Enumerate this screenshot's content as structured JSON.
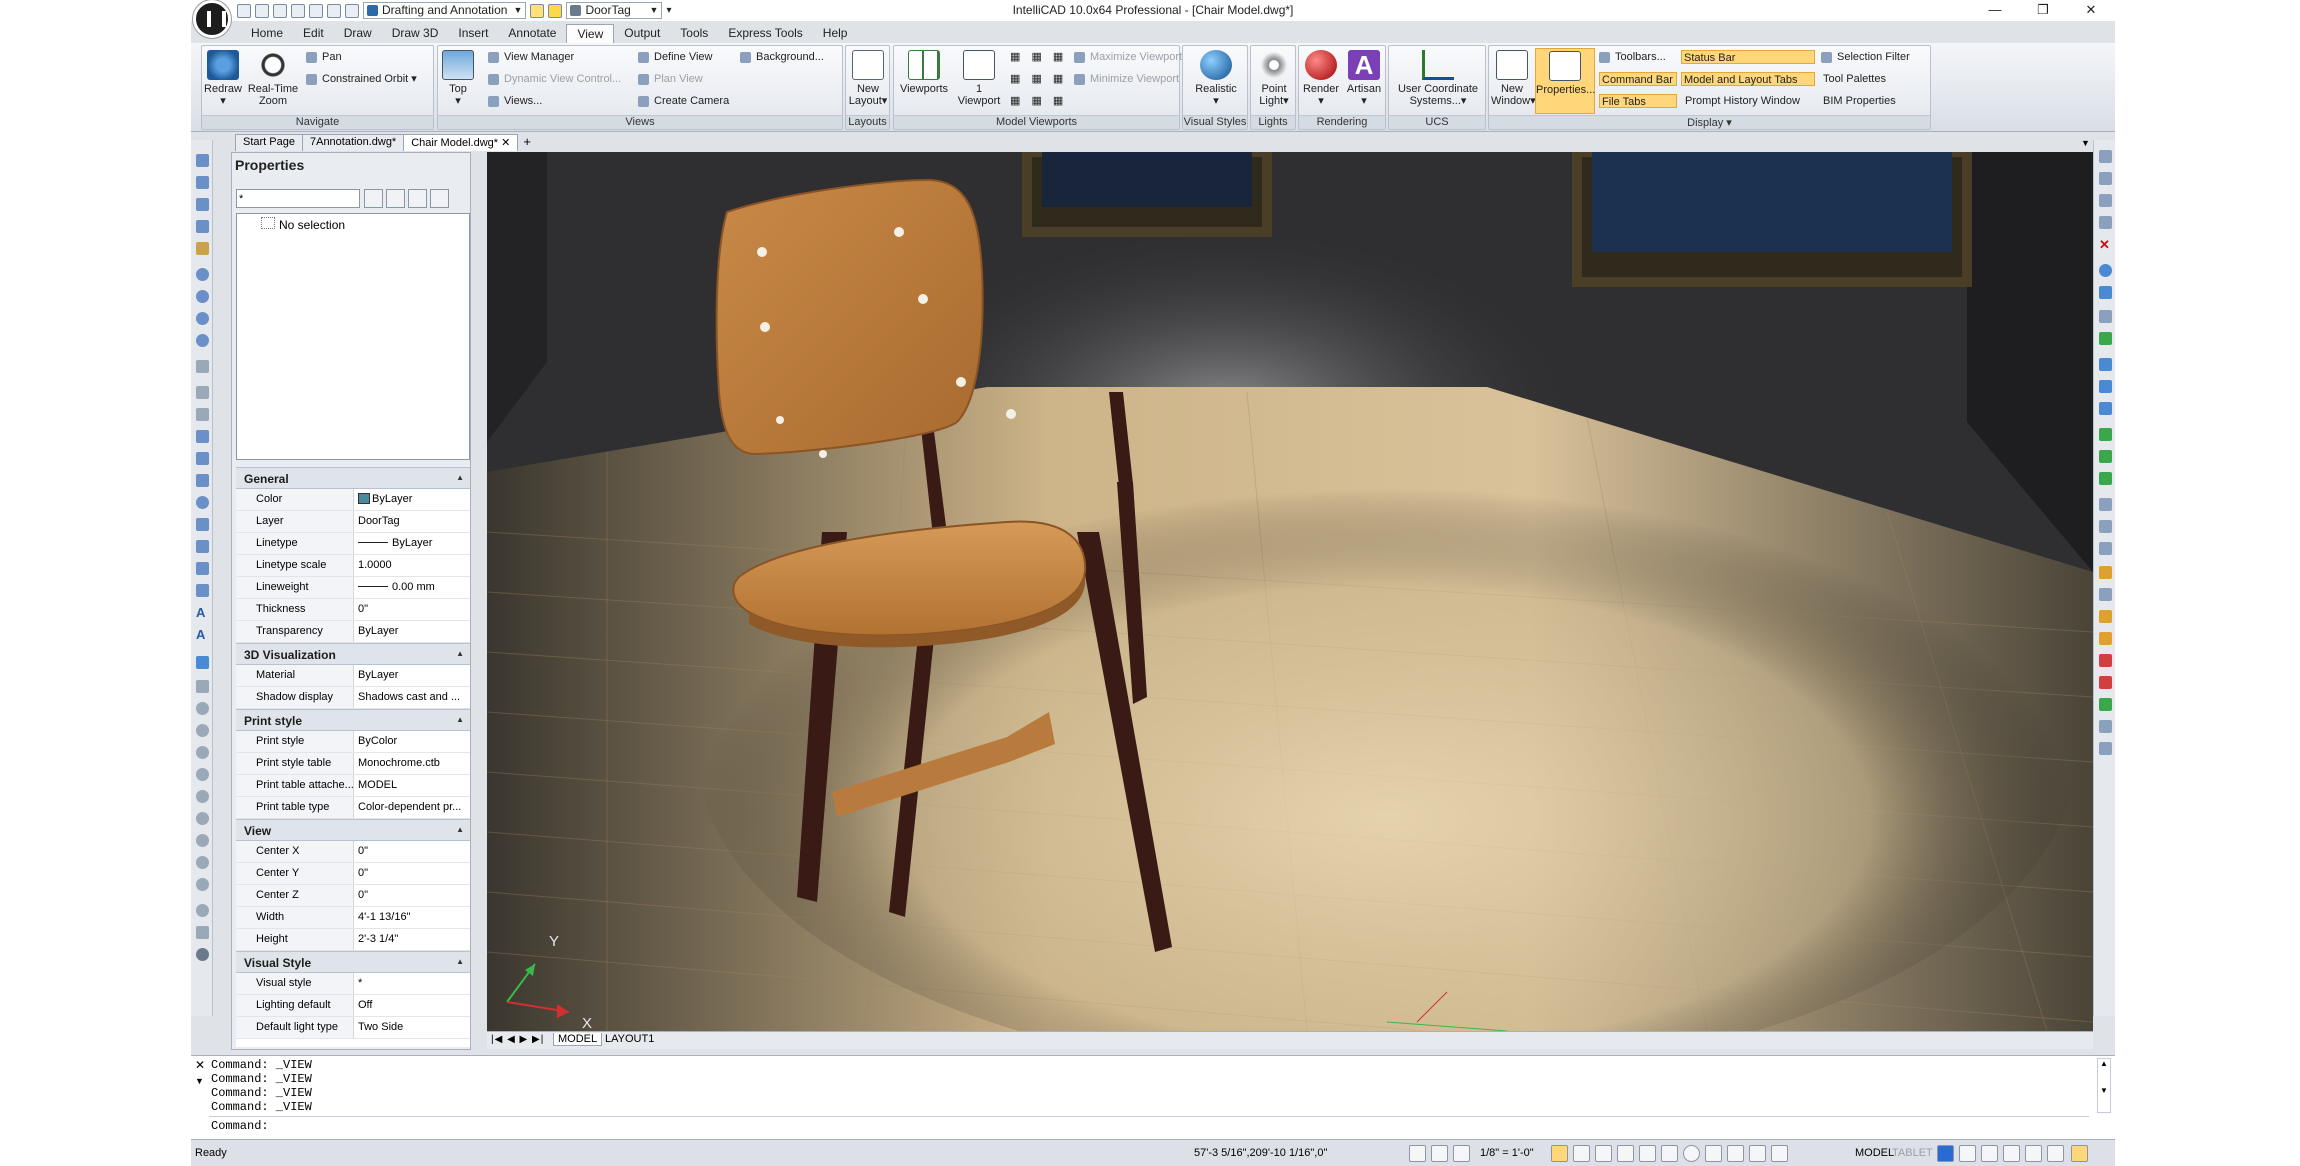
{
  "titlebar": {
    "title": "IntelliCAD 10.0x64 Professional - [Chair Model.dwg*]",
    "workspace": "Drafting and Annotation",
    "layer": "DoorTag",
    "minimize": "—",
    "restore": "❐",
    "close": "✕"
  },
  "menu": [
    "Home",
    "Edit",
    "Draw",
    "Draw 3D",
    "Insert",
    "Annotate",
    "View",
    "Output",
    "Tools",
    "Express Tools",
    "Help"
  ],
  "ribbon": {
    "navigate": {
      "title": "Navigate",
      "redraw": "Redraw",
      "realtime_zoom": "Real-Time Zoom",
      "pan": "Pan",
      "constrained_orbit": "Constrained Orbit"
    },
    "views": {
      "title": "Views",
      "top": "Top",
      "view_manager": "View Manager",
      "dynamic_view_control": "Dynamic View Control...",
      "views": "Views...",
      "define_view": "Define View",
      "plan_view": "Plan View",
      "create_camera": "Create Camera",
      "background": "Background..."
    },
    "layouts": {
      "title": "Layouts",
      "new_layout": "New Layout"
    },
    "model_viewports": {
      "title": "Model Viewports",
      "viewports": "Viewports",
      "one_viewport": "1 Viewport",
      "maximize_viewport": "Maximize Viewport",
      "minimize_viewport": "Minimize Viewport"
    },
    "visual_styles": {
      "title": "Visual Styles",
      "realistic": "Realistic"
    },
    "lights": {
      "title": "Lights",
      "point_light": "Point Light"
    },
    "rendering": {
      "title": "Rendering",
      "render": "Render",
      "artisan": "Artisan"
    },
    "ucs": {
      "title": "UCS",
      "user_coordinate_systems": "User Coordinate Systems..."
    },
    "display": {
      "title": "Display",
      "new_window": "New Window",
      "properties": "Properties...",
      "toolbars": "Toolbars...",
      "command_bar": "Command Bar",
      "file_tabs": "File Tabs",
      "status_bar": "Status Bar",
      "model_and_layout_tabs": "Model and Layout Tabs",
      "prompt_history_window": "Prompt History Window",
      "selection_filter": "Selection Filter",
      "tool_palettes": "Tool Palettes",
      "bim_properties": "BIM Properties"
    }
  },
  "doc_tabs": [
    "Start Page",
    "7Annotation.dwg*",
    "Chair Model.dwg*"
  ],
  "properties": {
    "title": "Properties",
    "filter_value": "*",
    "selection": "No selection",
    "sections": [
      {
        "name": "General",
        "rows": [
          {
            "key": "Color",
            "value": "ByLayer"
          },
          {
            "key": "Layer",
            "value": "DoorTag"
          },
          {
            "key": "Linetype",
            "value": "ByLayer"
          },
          {
            "key": "Linetype scale",
            "value": "1.0000"
          },
          {
            "key": "Lineweight",
            "value": "0.00 mm"
          },
          {
            "key": "Thickness",
            "value": "0\""
          },
          {
            "key": "Transparency",
            "value": "ByLayer"
          }
        ]
      },
      {
        "name": "3D Visualization",
        "rows": [
          {
            "key": "Material",
            "value": "ByLayer"
          },
          {
            "key": "Shadow display",
            "value": "Shadows cast and ..."
          }
        ]
      },
      {
        "name": "Print style",
        "rows": [
          {
            "key": "Print style",
            "value": "ByColor"
          },
          {
            "key": "Print style table",
            "value": "Monochrome.ctb"
          },
          {
            "key": "Print table attache...",
            "value": "MODEL"
          },
          {
            "key": "Print table type",
            "value": "Color-dependent pr..."
          }
        ]
      },
      {
        "name": "View",
        "rows": [
          {
            "key": "Center X",
            "value": "0\""
          },
          {
            "key": "Center Y",
            "value": "0\""
          },
          {
            "key": "Center Z",
            "value": "0\""
          },
          {
            "key": "Width",
            "value": "4'-1 13/16\""
          },
          {
            "key": "Height",
            "value": "2'-3 1/4\""
          }
        ]
      },
      {
        "name": "Visual Style",
        "rows": [
          {
            "key": "Visual style",
            "value": "*"
          },
          {
            "key": "Lighting default",
            "value": "Off"
          },
          {
            "key": "Default light type",
            "value": "Two Side"
          }
        ]
      }
    ]
  },
  "viewport": {
    "axis_y": "Y",
    "axis_x": "X"
  },
  "layout_tabs": [
    "MODEL",
    "LAYOUT1"
  ],
  "layout_nav": "|◀ ◀ ▶ ▶|",
  "command": {
    "history": [
      "Command: _VIEW",
      "Command: _VIEW",
      "Command: _VIEW",
      "Command: _VIEW"
    ],
    "prompt": "Command:"
  },
  "status": {
    "ready": "Ready",
    "coords": "57'-3 5/16\",209'-10 1/16\",0\"",
    "scale": "1/8\" = 1'-0\"",
    "model": "MODEL",
    "tablet": "TABLET"
  },
  "colors": {
    "accent_highlight": "#ffd77a",
    "wood_seat": "#c8843f",
    "frame_dark": "#3a1a14"
  }
}
